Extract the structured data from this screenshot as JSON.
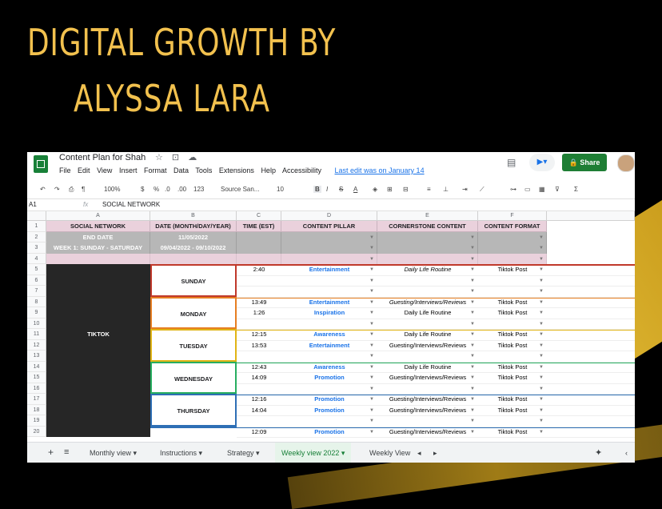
{
  "headline": {
    "line1": "DIGITAL GROWTH BY",
    "line2": "ALYSSA LARA"
  },
  "app": {
    "doc_title": "Content Plan for Shah",
    "menus": [
      "File",
      "Edit",
      "View",
      "Insert",
      "Format",
      "Data",
      "Tools",
      "Extensions",
      "Help",
      "Accessibility"
    ],
    "last_edit": "Last edit was on January 14",
    "share_label": "Share"
  },
  "toolbar": {
    "zoom": "100%",
    "currency": "$",
    "percent": "%",
    "dec_less": ".0",
    "dec_more": ".00",
    "format": "123",
    "font": "Source San...",
    "font_size": "10"
  },
  "formula": {
    "cell_ref": "A1",
    "fx": "fx",
    "value": "SOCIAL NETWORK"
  },
  "columns": [
    "A",
    "B",
    "C",
    "D",
    "E",
    "F"
  ],
  "rows": [
    "1",
    "2",
    "3",
    "4",
    "5",
    "6",
    "7",
    "8",
    "9",
    "10",
    "11",
    "12",
    "13",
    "14",
    "15",
    "16",
    "17",
    "18",
    "19",
    "20"
  ],
  "header": {
    "a": "SOCIAL NETWORK",
    "b": "DATE (MONTH/DAY/YEAR)",
    "c": "TIME (EST)",
    "d": "CONTENT PILLAR",
    "e": "CORNERSTONE CONTENT",
    "f": "CONTENT FORMAT"
  },
  "meta": {
    "end_date_label": "END DATE",
    "end_date": "11/05/2022",
    "week_label": "WEEK 1: SUNDAY - SATURDAY",
    "week_range": "09/04/2022 - 09/10/2022"
  },
  "network": "TIKTOK",
  "days": [
    "SUNDAY",
    "MONDAY",
    "TUESDAY",
    "WEDNESDAY",
    "THURSDAY"
  ],
  "entries": [
    {
      "row": 5,
      "time": "2:40",
      "pillar": "Entertainment",
      "content": "Daily Life Routine",
      "format": "Tiktok Post"
    },
    {
      "row": 8,
      "time": "13:49",
      "pillar": "Entertainment",
      "content": "Guesting/Interviews/Reviews",
      "format": "Tiktok Post"
    },
    {
      "row": 9,
      "time": "1:26",
      "pillar": "Inspiration",
      "content": "Daily Life Routine",
      "format": "Tiktok Post"
    },
    {
      "row": 11,
      "time": "12:15",
      "pillar": "Awareness",
      "content": "Daily Life Routine",
      "format": "Tiktok Post"
    },
    {
      "row": 12,
      "time": "13:53",
      "pillar": "Entertainment",
      "content": "Guesting/Interviews/Reviews",
      "format": "Tiktok Post"
    },
    {
      "row": 14,
      "time": "12:43",
      "pillar": "Awareness",
      "content": "Daily Life Routine",
      "format": "Tiktok Post"
    },
    {
      "row": 15,
      "time": "14:09",
      "pillar": "Promotion",
      "content": "Guesting/Interviews/Reviews",
      "format": "Tiktok Post"
    },
    {
      "row": 17,
      "time": "12:16",
      "pillar": "Promotion",
      "content": "Guesting/Interviews/Reviews",
      "format": "Tiktok Post"
    },
    {
      "row": 18,
      "time": "14:04",
      "pillar": "Promotion",
      "content": "Guesting/Interviews/Reviews",
      "format": "Tiktok Post"
    },
    {
      "row": 20,
      "time": "12:09",
      "pillar": "Promotion",
      "content": "Guesting/Interviews/Reviews",
      "format": "Tiktok Post"
    }
  ],
  "tabs": {
    "add": "+",
    "list": "≡",
    "items": [
      "Monthly view",
      "Instructions",
      "Strategy",
      "Weekly view 2022",
      "Weekly View"
    ]
  },
  "colors": {
    "headline": "#f2c14e",
    "share": "#1e7e34",
    "sunday": "#c0392b",
    "monday": "#e67e22",
    "tuesday": "#f1c40f",
    "wednesday": "#27ae60",
    "thursday": "#2e6fb5"
  }
}
